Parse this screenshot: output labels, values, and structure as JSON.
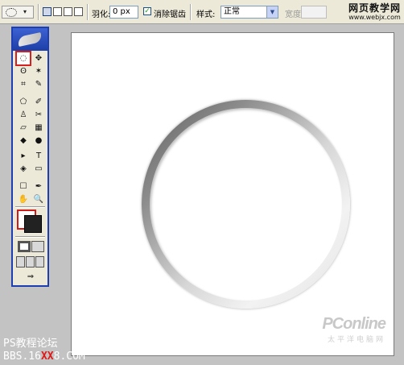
{
  "options_bar": {
    "tool_preset_icon": "elliptical-marquee-icon",
    "tool_preset_arrow": "▾",
    "feather_label": "羽化:",
    "feather_value": "0 px",
    "antialias_label": "消除锯齿",
    "antialias_checked": true,
    "style_label": "样式:",
    "style_value": "正常",
    "width_label": "宽度"
  },
  "watermark_top": {
    "line1": "网页教学网",
    "line2": "www.webjx.com"
  },
  "toolbox": {
    "selected_tool": "elliptical-marquee",
    "tools": [
      [
        "◌",
        "✥"
      ],
      [
        "ʘ",
        "✶"
      ],
      [
        "⌗",
        "✎"
      ],
      [
        "⬠",
        "✐"
      ],
      [
        "♙",
        "✂"
      ],
      [
        "▱",
        "▦"
      ],
      [
        "◆",
        "●"
      ],
      [
        "▸",
        "T"
      ],
      [
        "◈",
        "▭"
      ],
      [
        "☐",
        "✒"
      ],
      [
        "✋",
        "🔍"
      ]
    ],
    "colors": {
      "foreground": "#ffffff",
      "background": "#222222"
    }
  },
  "canvas": {
    "logo_main": "PConline",
    "logo_sub": "太平洋电脑网"
  },
  "watermark_bottom": {
    "line1": "PS教程论坛",
    "line2_prefix": "BBS.16",
    "line2_xx": "XX",
    "line2_suffix": "8.COM"
  }
}
